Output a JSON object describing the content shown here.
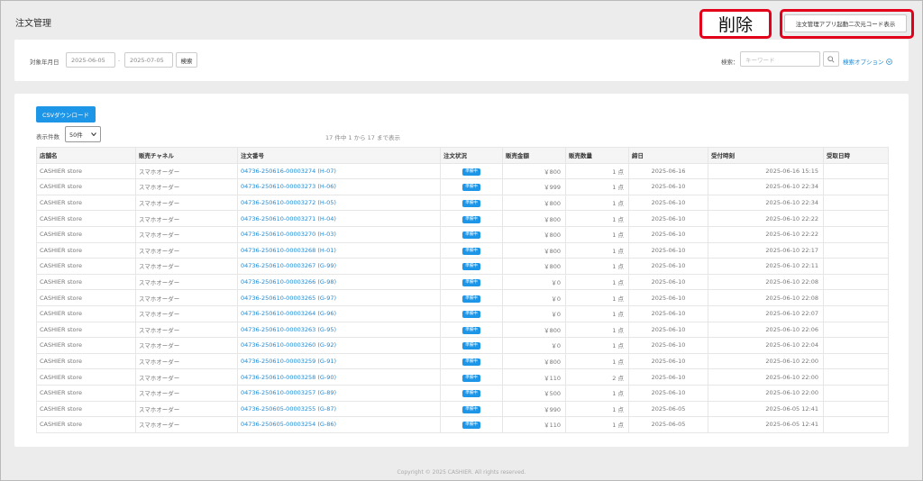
{
  "page": {
    "title": "注文管理",
    "copyright": "Copyright © 2025 CASHIER. All rights reserved."
  },
  "header": {
    "qr_button": "注文管理アプリ起動二次元コード表示",
    "delete_annotation": "削除"
  },
  "filter": {
    "date_label": "対象年月日",
    "date_from": "2025-06-05",
    "separator": "-",
    "date_to": "2025-07-05",
    "search_button": "検索",
    "keyword_label": "検索：",
    "keyword_placeholder": "キーワード",
    "options_link": "検索オプション"
  },
  "list": {
    "csv_button": "CSVダウンロード",
    "per_page_label": "表示件数",
    "per_page_value": "50件",
    "count_text": "17 件中 1 から 17 まで表示",
    "columns": [
      "店舗名",
      "販売チャネル",
      "注文番号",
      "注文状況",
      "販売金額",
      "販売数量",
      "締日",
      "受付時刻",
      "受取日時"
    ],
    "rows": [
      {
        "store": "CASHIER store",
        "channel": "スマホオーダー",
        "order": "04736-250616-00003274 (H-07)",
        "status": "準備中",
        "amount": "￥800",
        "qty": "1 点",
        "close": "2025-06-16",
        "received": "2025-06-16 15:15",
        "pickup": ""
      },
      {
        "store": "CASHIER store",
        "channel": "スマホオーダー",
        "order": "04736-250610-00003273 (H-06)",
        "status": "準備中",
        "amount": "￥999",
        "qty": "1 点",
        "close": "2025-06-10",
        "received": "2025-06-10 22:34",
        "pickup": ""
      },
      {
        "store": "CASHIER store",
        "channel": "スマホオーダー",
        "order": "04736-250610-00003272 (H-05)",
        "status": "準備中",
        "amount": "￥800",
        "qty": "1 点",
        "close": "2025-06-10",
        "received": "2025-06-10 22:34",
        "pickup": ""
      },
      {
        "store": "CASHIER store",
        "channel": "スマホオーダー",
        "order": "04736-250610-00003271 (H-04)",
        "status": "準備中",
        "amount": "￥800",
        "qty": "1 点",
        "close": "2025-06-10",
        "received": "2025-06-10 22:22",
        "pickup": ""
      },
      {
        "store": "CASHIER store",
        "channel": "スマホオーダー",
        "order": "04736-250610-00003270 (H-03)",
        "status": "準備中",
        "amount": "￥800",
        "qty": "1 点",
        "close": "2025-06-10",
        "received": "2025-06-10 22:22",
        "pickup": ""
      },
      {
        "store": "CASHIER store",
        "channel": "スマホオーダー",
        "order": "04736-250610-00003268 (H-01)",
        "status": "準備中",
        "amount": "￥800",
        "qty": "1 点",
        "close": "2025-06-10",
        "received": "2025-06-10 22:17",
        "pickup": ""
      },
      {
        "store": "CASHIER store",
        "channel": "スマホオーダー",
        "order": "04736-250610-00003267 (G-99)",
        "status": "準備中",
        "amount": "￥800",
        "qty": "1 点",
        "close": "2025-06-10",
        "received": "2025-06-10 22:11",
        "pickup": ""
      },
      {
        "store": "CASHIER store",
        "channel": "スマホオーダー",
        "order": "04736-250610-00003266 (G-98)",
        "status": "準備中",
        "amount": "￥0",
        "qty": "1 点",
        "close": "2025-06-10",
        "received": "2025-06-10 22:08",
        "pickup": ""
      },
      {
        "store": "CASHIER store",
        "channel": "スマホオーダー",
        "order": "04736-250610-00003265 (G-97)",
        "status": "準備中",
        "amount": "￥0",
        "qty": "1 点",
        "close": "2025-06-10",
        "received": "2025-06-10 22:08",
        "pickup": ""
      },
      {
        "store": "CASHIER store",
        "channel": "スマホオーダー",
        "order": "04736-250610-00003264 (G-96)",
        "status": "準備中",
        "amount": "￥0",
        "qty": "1 点",
        "close": "2025-06-10",
        "received": "2025-06-10 22:07",
        "pickup": ""
      },
      {
        "store": "CASHIER store",
        "channel": "スマホオーダー",
        "order": "04736-250610-00003263 (G-95)",
        "status": "準備中",
        "amount": "￥800",
        "qty": "1 点",
        "close": "2025-06-10",
        "received": "2025-06-10 22:06",
        "pickup": ""
      },
      {
        "store": "CASHIER store",
        "channel": "スマホオーダー",
        "order": "04736-250610-00003260 (G-92)",
        "status": "準備中",
        "amount": "￥0",
        "qty": "1 点",
        "close": "2025-06-10",
        "received": "2025-06-10 22:04",
        "pickup": ""
      },
      {
        "store": "CASHIER store",
        "channel": "スマホオーダー",
        "order": "04736-250610-00003259 (G-91)",
        "status": "準備中",
        "amount": "￥800",
        "qty": "1 点",
        "close": "2025-06-10",
        "received": "2025-06-10 22:00",
        "pickup": ""
      },
      {
        "store": "CASHIER store",
        "channel": "スマホオーダー",
        "order": "04736-250610-00003258 (G-90)",
        "status": "準備中",
        "amount": "￥110",
        "qty": "2 点",
        "close": "2025-06-10",
        "received": "2025-06-10 22:00",
        "pickup": ""
      },
      {
        "store": "CASHIER store",
        "channel": "スマホオーダー",
        "order": "04736-250610-00003257 (G-89)",
        "status": "準備中",
        "amount": "￥500",
        "qty": "1 点",
        "close": "2025-06-10",
        "received": "2025-06-10 22:00",
        "pickup": ""
      },
      {
        "store": "CASHIER store",
        "channel": "スマホオーダー",
        "order": "04736-250605-00003255 (G-87)",
        "status": "準備中",
        "amount": "￥990",
        "qty": "1 点",
        "close": "2025-06-05",
        "received": "2025-06-05 12:41",
        "pickup": ""
      },
      {
        "store": "CASHIER store",
        "channel": "スマホオーダー",
        "order": "04736-250605-00003254 (G-86)",
        "status": "準備中",
        "amount": "￥110",
        "qty": "1 点",
        "close": "2025-06-05",
        "received": "2025-06-05 12:41",
        "pickup": ""
      }
    ]
  }
}
